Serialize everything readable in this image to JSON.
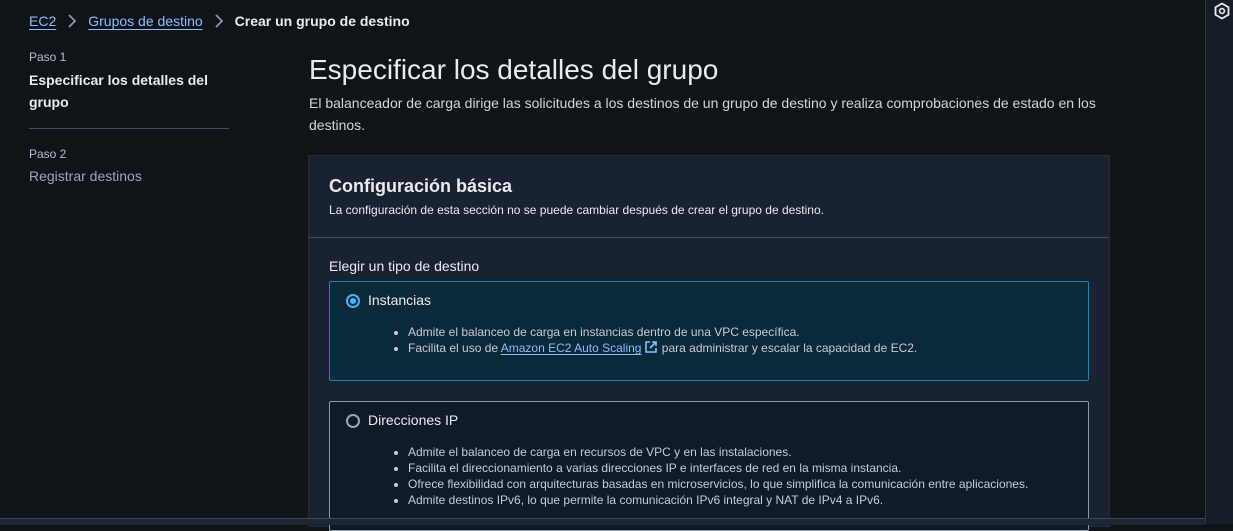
{
  "breadcrumb": {
    "items": [
      "EC2",
      "Grupos de destino"
    ],
    "current": "Crear un grupo de destino"
  },
  "steps": [
    {
      "num": "Paso 1",
      "title": "Especificar los detalles del grupo"
    },
    {
      "num": "Paso 2",
      "title": "Registrar destinos"
    }
  ],
  "main": {
    "title": "Especificar los detalles del grupo",
    "description": "El balanceador de carga dirige las solicitudes a los destinos de un grupo de destino y realiza comprobaciones de estado en los destinos."
  },
  "basic_config": {
    "title": "Configuración básica",
    "subtitle": "La configuración de esta sección no se puede cambiar después de crear el grupo de destino.",
    "target_type_label": "Elegir un tipo de destino",
    "options": [
      {
        "label": "Instancias",
        "selected": true,
        "bullets": [
          "Admite el balanceo de carga en instancias dentro de una VPC específica.",
          {
            "prefix": "Facilita el uso de ",
            "link": "Amazon EC2 Auto Scaling",
            "suffix": " para administrar y escalar la capacidad de EC2."
          }
        ]
      },
      {
        "label": "Direcciones IP",
        "selected": false,
        "bullets": [
          "Admite el balanceo de carga en recursos de VPC y en las instalaciones.",
          "Facilita el direccionamiento a varias direcciones IP e interfaces de red en la misma instancia.",
          "Ofrece flexibilidad con arquitecturas basadas en microservicios, lo que simplifica la comunicación entre aplicaciones.",
          "Admite destinos IPv6, lo que permite la comunicación IPv6 integral y NAT de IPv4 a IPv6."
        ]
      }
    ]
  },
  "colors": {
    "background": "#0f1419",
    "panel": "#192231",
    "link": "#89bdff",
    "accent": "#42b4ff",
    "selected_border": "#0a8ab8"
  },
  "icons": {
    "breadcrumb_separator": "chevron-right-icon",
    "external_link": "external-link-icon",
    "rail": "settings-hex-icon"
  }
}
